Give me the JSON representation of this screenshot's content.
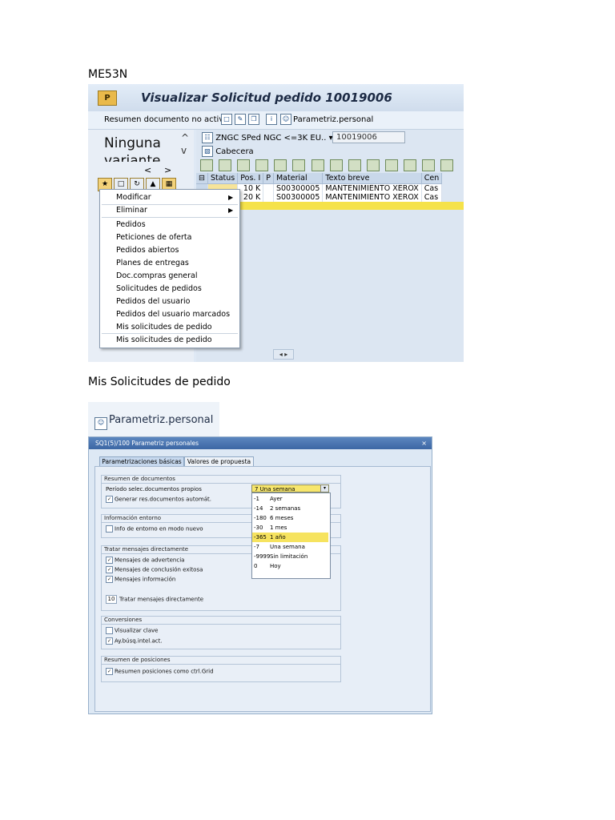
{
  "caption1": "ME53N",
  "caption2": "Mis Solicitudes de pedido",
  "shot1": {
    "title": "Visualizar Solicitud pedido 10019006",
    "app_icon_text": "P",
    "toolbar": {
      "summary_label": "Resumen documento no activo",
      "params_label": "Parametriz.personal",
      "info_icon_text": "i"
    },
    "variant_line1": "Ninguna",
    "variant_line2": "variante",
    "arrow_up": "^",
    "arrow_down": "v",
    "nav_prev": "<",
    "nav_next": ">",
    "header_selector": "ZNGC SPed NGC <=3K EU..",
    "doc_number": "10019006",
    "cabecera_label": "Cabecera",
    "table": {
      "headers": [
        "Status",
        "Pos. I",
        "P",
        "Material",
        "Texto breve",
        "Cen"
      ],
      "rows": [
        [
          "",
          "10 K",
          "",
          "S00300005",
          "MANTENIMIENTO XEROX",
          "Cas"
        ],
        [
          "",
          "20 K",
          "",
          "S00300005",
          "MANTENIMIENTO XEROX",
          "Cas"
        ]
      ]
    },
    "scroll_label": "◂ ▸",
    "menu": {
      "modificar": "Modificar",
      "eliminar": "Eliminar",
      "items": [
        "Pedidos",
        "Peticiones de oferta",
        "Pedidos abiertos",
        "Planes de entregas",
        "Doc.compras general",
        "Solicitudes de pedidos",
        "Pedidos del usuario",
        "Pedidos del usuario marcados",
        "Mis solicitudes de pedido"
      ],
      "last_item": "Mis solicitudes de pedido"
    }
  },
  "shot2": {
    "header_label": "Parametriz.personal",
    "dialog_title": "SQ1(5)/100 Parametriz personales",
    "close_label": "×",
    "tabs": [
      "Parametrizaciones básicas",
      "Valores de propuesta"
    ],
    "groups": {
      "resumen": {
        "title": "Resumen de documentos",
        "period_label": "Período selec.documentos propios",
        "generate_label": "Generar res.documentos automát."
      },
      "entorno": {
        "title": "Información entorno",
        "info_label": "Info de entorno en modo nuevo"
      },
      "mensajes": {
        "title": "Tratar mensajes directamente",
        "advertencia": "Mensajes de advertencia",
        "conclusion": "Mensajes de conclusión exitosa",
        "informacion": "Mensajes información",
        "count_value": "10",
        "count_label": "Tratar mensajes directamente"
      },
      "conversiones": {
        "title": "Conversiones",
        "visualizar": "Visualizar clave",
        "ayuda": "Ay.búsq.intel.act."
      },
      "posiciones": {
        "title": "Resumen de posiciones",
        "ctrl": "Resumen posiciones como ctrl.Grid"
      }
    },
    "dropdown": {
      "selected": "7 Una semana",
      "options": [
        {
          "code": "-1",
          "label": "Ayer"
        },
        {
          "code": "-14",
          "label": "2 semanas"
        },
        {
          "code": "-180",
          "label": "6 meses"
        },
        {
          "code": "-30",
          "label": "1 mes"
        },
        {
          "code": "-365",
          "label": "1 año"
        },
        {
          "code": "-7",
          "label": "Una semana"
        },
        {
          "code": "-9999",
          "label": "Sin limitación"
        },
        {
          "code": "0",
          "label": "Hoy"
        }
      ]
    }
  },
  "checkmark": "✓"
}
